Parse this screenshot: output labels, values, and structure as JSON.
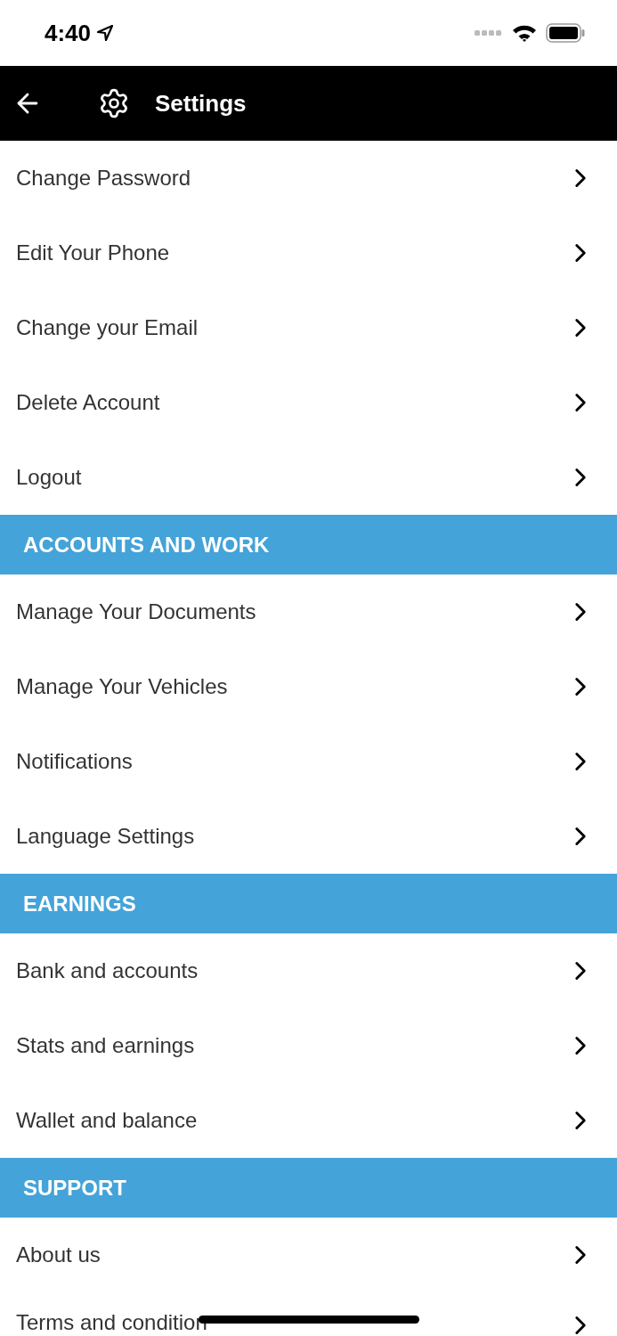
{
  "status_bar": {
    "time": "4:40"
  },
  "header": {
    "title": "Settings"
  },
  "sections": [
    {
      "items": [
        "Change Password",
        "Edit Your Phone",
        "Change your Email",
        "Delete Account",
        "Logout"
      ]
    },
    {
      "title": "ACCOUNTS AND WORK",
      "items": [
        "Manage Your Documents",
        "Manage Your Vehicles",
        "Notifications",
        "Language Settings"
      ]
    },
    {
      "title": "EARNINGS",
      "items": [
        "Bank and accounts",
        "Stats and earnings",
        "Wallet and balance"
      ]
    },
    {
      "title": "SUPPORT",
      "items": [
        "About us",
        "Terms and condition"
      ]
    }
  ]
}
